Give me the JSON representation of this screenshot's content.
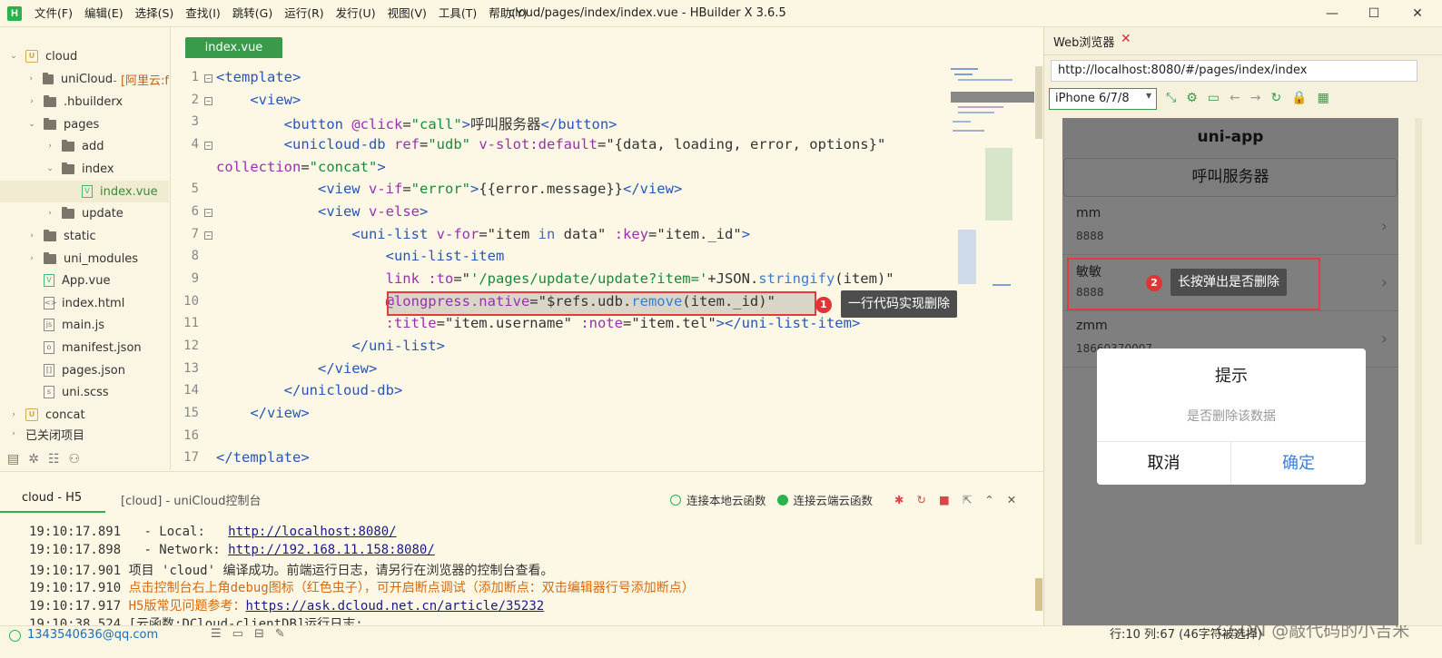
{
  "titlebar": {
    "logo": "H",
    "menu": [
      "文件(F)",
      "编辑(E)",
      "选择(S)",
      "查找(I)",
      "跳转(G)",
      "运行(R)",
      "发行(U)",
      "视图(V)",
      "工具(T)",
      "帮助(Y)"
    ],
    "title": "cloud/pages/index/index.vue - HBuilder X 3.6.5",
    "minimize": "—",
    "maximize": "☐",
    "close": "✕"
  },
  "sidebar": {
    "items": [
      {
        "label": "cloud",
        "arrow": "⌄",
        "icon": "project-icon"
      },
      {
        "label": "uniCloud",
        "extra": " - [阿里云:f",
        "arrow": "›",
        "icon": "folder-icon"
      },
      {
        "label": ".hbuilderx",
        "arrow": "›",
        "icon": "folder-icon"
      },
      {
        "label": "pages",
        "arrow": "⌄",
        "icon": "folder-icon"
      },
      {
        "label": "add",
        "arrow": "›",
        "icon": "folder-icon"
      },
      {
        "label": "index",
        "arrow": "⌄",
        "icon": "folder-icon"
      },
      {
        "label": "index.vue",
        "arrow": "",
        "icon": "vue-file-icon"
      },
      {
        "label": "update",
        "arrow": "›",
        "icon": "folder-icon"
      },
      {
        "label": "static",
        "arrow": "›",
        "icon": "folder-icon"
      },
      {
        "label": "uni_modules",
        "arrow": "›",
        "icon": "folder-icon"
      },
      {
        "label": "App.vue",
        "arrow": "",
        "icon": "vue-file-icon"
      },
      {
        "label": "index.html",
        "arrow": "",
        "icon": "html-file-icon"
      },
      {
        "label": "main.js",
        "arrow": "",
        "icon": "js-file-icon"
      },
      {
        "label": "manifest.json",
        "arrow": "",
        "icon": "json-file-icon"
      },
      {
        "label": "pages.json",
        "arrow": "",
        "icon": "json-file-icon"
      },
      {
        "label": "uni.scss",
        "arrow": "",
        "icon": "scss-file-icon"
      },
      {
        "label": "concat",
        "arrow": "›",
        "icon": "project-icon"
      },
      {
        "label": "已关闭项目",
        "arrow": "›",
        "icon": ""
      }
    ]
  },
  "editor": {
    "tab": "index.vue",
    "line_numbers": [
      "1",
      "2",
      "3",
      "4",
      "",
      "5",
      "6",
      "7",
      "8",
      "9",
      "10",
      "11",
      "12",
      "13",
      "14",
      "15",
      "16",
      "17"
    ]
  },
  "annotations": {
    "badge1": "1",
    "tip1": "一行代码实现删除",
    "badge2": "2",
    "tip2": "长按弹出是否删除"
  },
  "console": {
    "tab_active": "cloud - H5",
    "tab_other": "[cloud] - uniCloud控制台",
    "local_fn": "连接本地云函数",
    "cloud_fn": "连接云端云函数",
    "lines": {
      "l1_time": "19:10:17.891",
      "l1_text": "   - Local:   ",
      "l1_link": "http://localhost:8080/",
      "l2_time": "19:10:17.898",
      "l2_text": "   - Network: ",
      "l2_link": "http://192.168.11.158:8080/",
      "l3_time": "19:10:17.901",
      "l3_text": " 项目 'cloud' 编译成功。前端运行日志，请另行在浏览器的控制台查看。",
      "l4_time": "19:10:17.910",
      "l4_text": " 点击控制台右上角debug图标（红色虫子），可开启断点调试（添加断点：双击编辑器行号添加断点）",
      "l5_time": "19:10:17.917",
      "l5_text": " H5版常见问题参考：",
      "l5_link": "https://ask.dcloud.net.cn/article/35232",
      "l6_time": "19:10:38.524",
      "l6_text": " [云函数:DCloud-clientDB]运行日志:"
    }
  },
  "status": {
    "account": "1343540636@qq.com",
    "position": "行:10  列:67 (46字符被选择)",
    "watermark": "CSDN @敲代码的小吉米"
  },
  "browser": {
    "tab": "Web浏览器",
    "tab_close": "✕",
    "url": "http://localhost:8080/#/pages/index/index",
    "device": "iPhone 6/7/8",
    "device_arrow": "▼",
    "tools": [
      "⤡",
      "⚙",
      "▭",
      "←",
      "→",
      "↻",
      "🔒",
      "▦"
    ],
    "app": {
      "nav_title": "uni-app",
      "call_button": "呼叫服务器",
      "items": [
        {
          "name": "mm",
          "tel": "8888"
        },
        {
          "name": "敏敏",
          "tel": "8888"
        },
        {
          "name": "zmm",
          "tel": "18660370007"
        }
      ],
      "chevron": "›",
      "modal": {
        "title": "提示",
        "content": "是否删除该数据",
        "cancel": "取消",
        "confirm": "确定"
      }
    }
  }
}
